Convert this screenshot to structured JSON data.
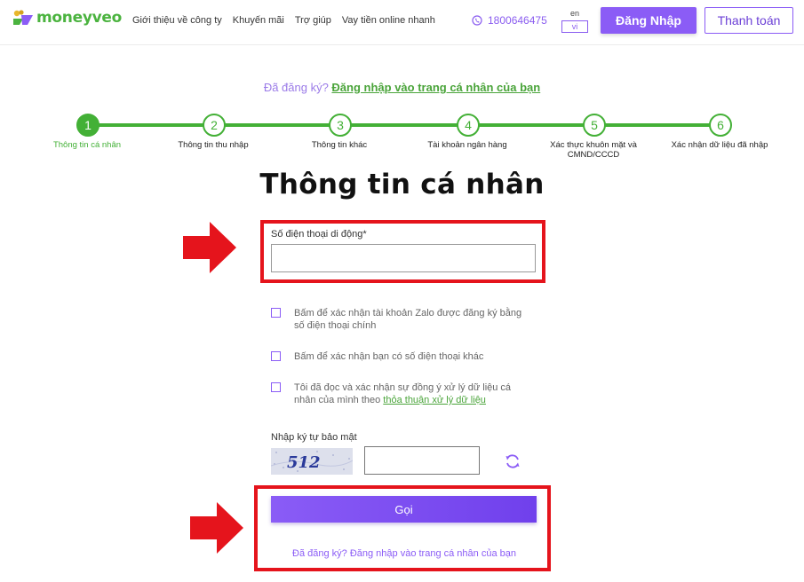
{
  "header": {
    "brand": "moneyveo",
    "nav": [
      "Giới thiệu về công ty",
      "Khuyến mãi",
      "Trợ giúp",
      "Vay tiền online nhanh"
    ],
    "phone": "1800646475",
    "lang_en": "en",
    "lang_vi": "vi",
    "login_label": "Đăng Nhập",
    "pay_label": "Thanh toán"
  },
  "registered_top": {
    "question": "Đã đăng ký? ",
    "link": "Đăng nhập vào trang cá nhân của bạn"
  },
  "steps": [
    {
      "num": "1",
      "label": "Thông tin cá nhân",
      "active": true
    },
    {
      "num": "2",
      "label": "Thông tin thu nhập",
      "active": false
    },
    {
      "num": "3",
      "label": "Thông tin khác",
      "active": false
    },
    {
      "num": "4",
      "label": "Tài khoản ngân hàng",
      "active": false
    },
    {
      "num": "5",
      "label": "Xác thực khuôn mặt và CMND/CCCD",
      "active": false
    },
    {
      "num": "6",
      "label": "Xác nhận dữ liệu đã nhập",
      "active": false
    }
  ],
  "form": {
    "title": "Thông tin cá nhân",
    "phone_label": "Số điện thoại di động*",
    "phone_value": "",
    "checkbox_zalo": "Bấm để xác nhận tài khoản Zalo được đăng ký bằng số điện thoại chính",
    "checkbox_other_phone": "Bấm để xác nhận bạn có số điện thoại khác",
    "checkbox_consent_text": "Tôi đã đọc và xác nhận sự đồng ý xử lý dữ liệu cá nhân của mình theo ",
    "checkbox_consent_link": "thỏa thuận xử lý dữ liệu",
    "captcha_label": "Nhập ký tự bảo mật",
    "captcha_text": "512",
    "captcha_value": "",
    "submit_label": "Gọi",
    "registered_bottom": "Đã đăng ký? Đăng nhập vào trang cá nhân của bạn"
  },
  "colors": {
    "brand_green": "#43b036",
    "brand_purple": "#8b5cf6",
    "annotation_red": "#e5141c"
  },
  "icons": [
    "logo-icon",
    "phone-icon",
    "refresh-icon",
    "red-arrow-icon"
  ]
}
